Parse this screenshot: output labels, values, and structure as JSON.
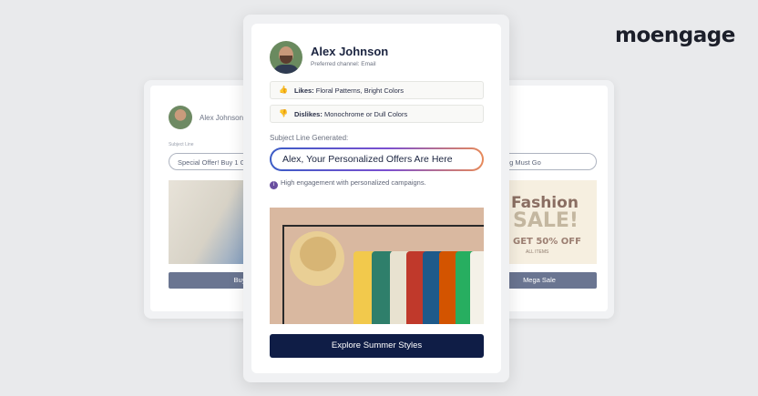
{
  "brand": {
    "logo_text": "moengage"
  },
  "left_card": {
    "name": "Alex Johnson",
    "subject_label": "Subject Line",
    "subject": "Special Offer! Buy 1 G",
    "button": "Buy 1 G"
  },
  "right_card": {
    "subject": "ng Must Go",
    "poster": {
      "line1": "Fashion",
      "line2": "SALE!",
      "line3": "GET 50% OFF",
      "line4": "ALL ITEMS"
    },
    "button": "Mega Sale"
  },
  "profile": {
    "name": "Alex Johnson",
    "channel": "Preferred channel: Email"
  },
  "preferences": {
    "likes_label": "Likes:",
    "likes_value": " Floral Patterns, Bright Colors",
    "dislikes_label": "Dislikes:",
    "dislikes_value": " Monochrome or Dull Colors"
  },
  "subject_section": {
    "label": "Subject Line Generated:",
    "value": "Alex, Your Personalized Offers Are Here",
    "insight": "High engagement with personalized campaigns."
  },
  "cta": {
    "label": "Explore Summer Styles"
  },
  "icons": {
    "likes": "thumbs-up-icon",
    "dislikes": "thumbs-down-icon",
    "insight": "info-icon"
  },
  "colors": {
    "cta_bg": "#0f1d46",
    "back_button_bg": "#6a7591",
    "subject_gradient": [
      "#3b5cc6",
      "#7b4fd0",
      "#e78a5a"
    ]
  }
}
